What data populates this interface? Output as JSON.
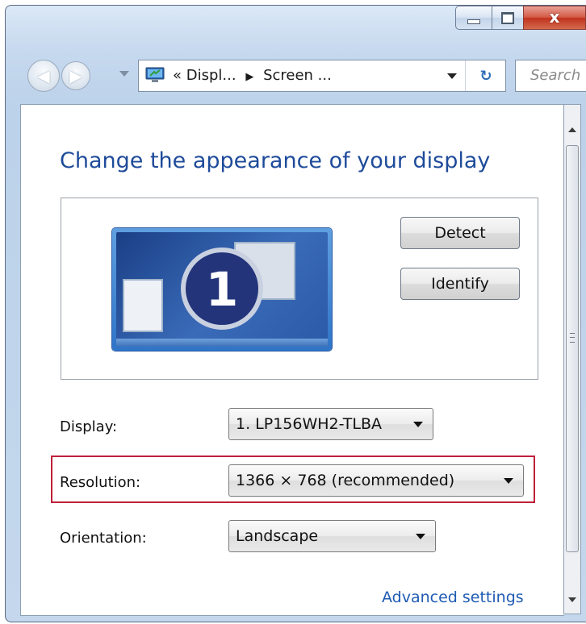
{
  "window": {
    "caption_buttons": {
      "minimize_icon": "minimize-icon",
      "maximize_icon": "maximize-icon",
      "close_glyph": "x"
    }
  },
  "nav": {
    "back_icon": "back-arrow-icon",
    "forward_icon": "forward-arrow-icon",
    "address": {
      "prefix": "«",
      "crumb1": "Displ...",
      "sep": "▶",
      "crumb2": "Screen ..."
    },
    "refresh_glyph": "↻",
    "search_placeholder": "Search"
  },
  "main": {
    "title": "Change the appearance of your display",
    "monitor_number": "1",
    "detect_label": "Detect",
    "identify_label": "Identify",
    "display": {
      "label": "Display:",
      "value": "1. LP156WH2-TLBA"
    },
    "resolution": {
      "label": "Resolution:",
      "value": "1366 × 768 (recommended)"
    },
    "orientation": {
      "label": "Orientation:",
      "value": "Landscape"
    },
    "advanced_link": "Advanced settings"
  },
  "colors": {
    "title": "#1e4b9a",
    "link": "#1e5bb4",
    "highlight_border": "#c0203a",
    "close_button": "#c0321c"
  }
}
